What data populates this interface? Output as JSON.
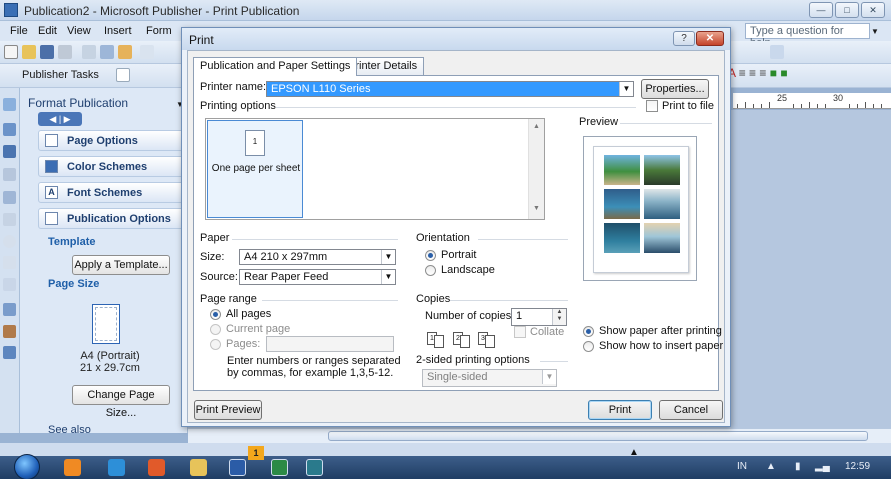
{
  "window": {
    "title": "Publication2 - Microsoft Publisher - Print Publication",
    "controls": [
      "minimize",
      "maximize",
      "close"
    ]
  },
  "menu": {
    "items": [
      "File",
      "Edit",
      "View",
      "Insert",
      "Form"
    ],
    "help_placeholder": "Type a question for help"
  },
  "toolbar": {
    "publisher_tasks": "Publisher Tasks"
  },
  "ruler": {
    "numbers": [
      "25",
      "30"
    ]
  },
  "task_pane": {
    "title": "Format Publication",
    "sections": [
      "Page Options",
      "Color Schemes",
      "Font Schemes",
      "Publication Options"
    ],
    "template_heading": "Template",
    "apply_template_button": "Apply a Template...",
    "page_size_heading": "Page Size",
    "page_size_name": "A4 (Portrait)",
    "page_size_dims": "21 x 29.7cm",
    "change_page_size_button": "Change Page Size...",
    "see_also": "See also"
  },
  "dialog": {
    "title": "Print",
    "tabs": [
      "Publication and Paper Settings",
      "Printer Details"
    ],
    "printer_name_label": "Printer name:",
    "printer_name_value": "EPSON L110 Series",
    "properties_button": "Properties...",
    "printing_options_label": "Printing options",
    "print_to_file_label": "Print to file",
    "option_card_number": "1",
    "option_card_label": "One page per sheet",
    "paper_label": "Paper",
    "size_label": "Size:",
    "size_value": "A4 210 x 297mm",
    "source_label": "Source:",
    "source_value": "Rear Paper Feed",
    "orientation_label": "Orientation",
    "portrait_label": "Portrait",
    "landscape_label": "Landscape",
    "page_range_label": "Page range",
    "all_pages_label": "All pages",
    "current_page_label": "Current page",
    "pages_label": "Pages:",
    "pages_hint": "Enter numbers or ranges separated by commas, for example 1,3,5-12.",
    "copies_label": "Copies",
    "number_of_copies_label": "Number of copies:",
    "number_of_copies_value": "1",
    "collate_label": "Collate",
    "two_sided_label": "2-sided printing options",
    "two_sided_value": "Single-sided",
    "preview_label": "Preview",
    "show_paper_label": "Show paper after printing",
    "show_insert_label": "Show how to insert paper",
    "print_preview_button": "Print Preview",
    "print_button": "Print",
    "cancel_button": "Cancel",
    "selected_orientation": "Portrait",
    "selected_range": "All pages",
    "selected_preview_mode": "Show paper after printing"
  },
  "taskbar": {
    "badge": "1",
    "lang": "IN",
    "time": "12:59",
    "apps": [
      "start",
      "media-player",
      "chrome",
      "firefox",
      "explorer",
      "word",
      "excel",
      "publisher"
    ]
  },
  "colors": {
    "accent": "#3399ff",
    "title_bar": "#c8d9ee",
    "close_button": "#c4432a",
    "badge": "#f3a71c"
  }
}
